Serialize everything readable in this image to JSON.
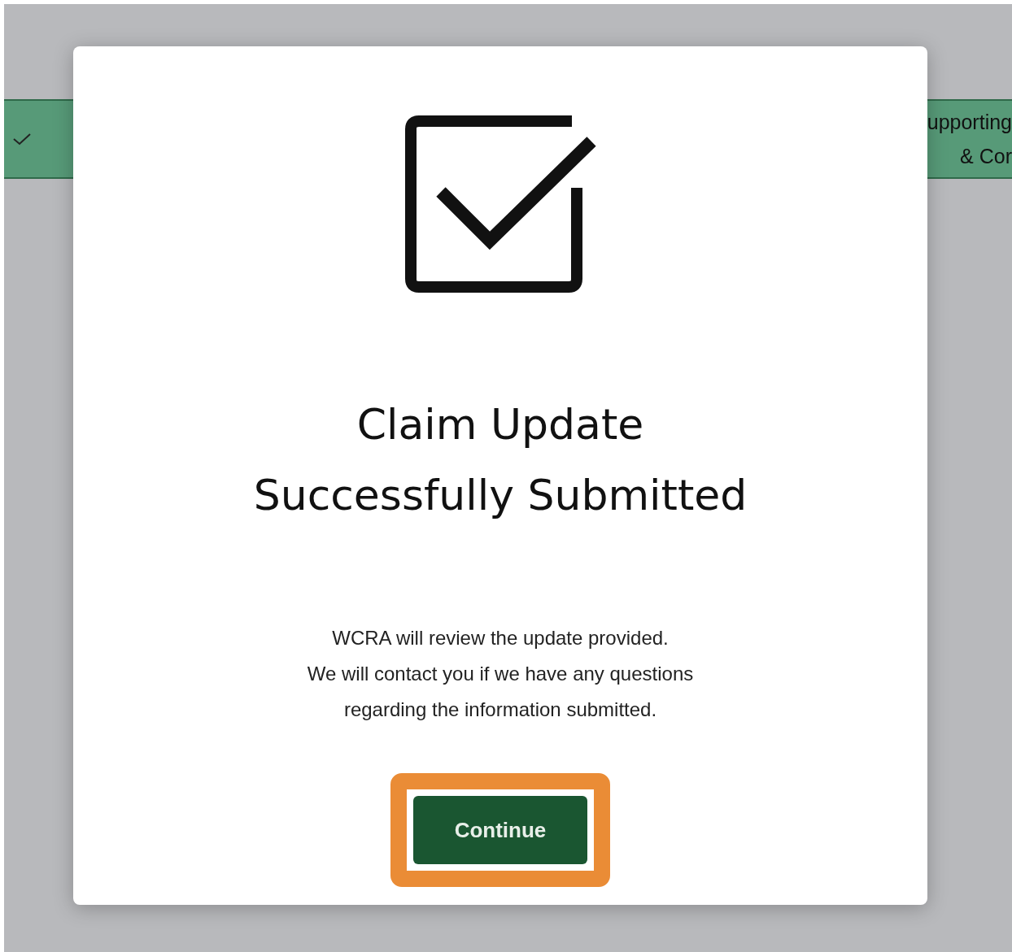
{
  "stepper": {
    "steps": [
      {
        "completed": true
      },
      {
        "completed": false,
        "label_lines": [
          "upporting",
          "& Cor"
        ]
      }
    ]
  },
  "dialog": {
    "title_lines": [
      "Claim Update",
      "Successfully Submitted"
    ],
    "message_lines": [
      "WCRA will review the update provided.",
      "We will contact you if we have any questions",
      "regarding the information submitted."
    ],
    "button": {
      "label": "Continue",
      "highlighted": true
    }
  }
}
